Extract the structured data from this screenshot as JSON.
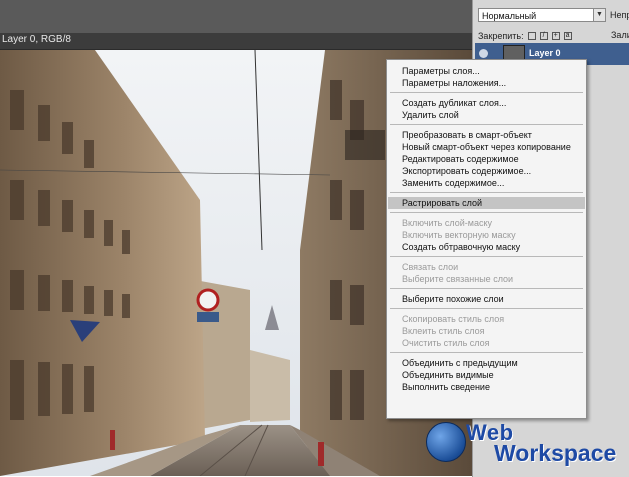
{
  "document": {
    "tab_title": "Layer 0, RGB/8"
  },
  "layers_panel": {
    "blend_mode": "Нормальный",
    "opacity_label": "Непр",
    "lock_label": "Закрепить:",
    "fill_label": "Зали",
    "layer_name": "Layer 0"
  },
  "context_menu": {
    "groups": [
      [
        "Параметры слоя...",
        "Параметры наложения..."
      ],
      [
        "Создать дубликат слоя...",
        "Удалить слой"
      ],
      [
        "Преобразовать в смарт-объект",
        "Новый смарт-объект через копирование",
        "Редактировать содержимое",
        "Экспортировать содержимое...",
        "Заменить содержимое..."
      ],
      [
        "Растрировать слой"
      ],
      [
        "Включить слой-маску",
        "Включить векторную маску",
        "Создать обтравочную маску"
      ],
      [
        "Связать слои",
        "Выберите связанные слои"
      ],
      [
        "Выберите похожие слои"
      ],
      [
        "Скопировать стиль слоя",
        "Вклеить стиль слоя",
        "Очистить стиль слоя"
      ],
      [
        "Объединить с предыдущим",
        "Объединить видимые",
        "Выполнить сведение"
      ]
    ],
    "highlighted_item": "Растрировать слой",
    "disabled_items": [
      "Включить слой-маску",
      "Включить векторную маску",
      "Связать слои",
      "Выберите связанные слои",
      "Скопировать стиль слоя",
      "Вклеить стиль слоя",
      "Очистить стиль слоя"
    ]
  },
  "watermark": {
    "line1": "Web",
    "line2": "Workspace"
  },
  "icons": {
    "eye": "eye-icon",
    "dropdown": "chevron-down-icon",
    "globe": "globe-icon"
  },
  "colors": {
    "menu_bg": "#f4f4f4",
    "menu_highlight": "#c4c4c4",
    "layer_selected": "#3f5f8f",
    "watermark_text": "#1e4aa5"
  }
}
